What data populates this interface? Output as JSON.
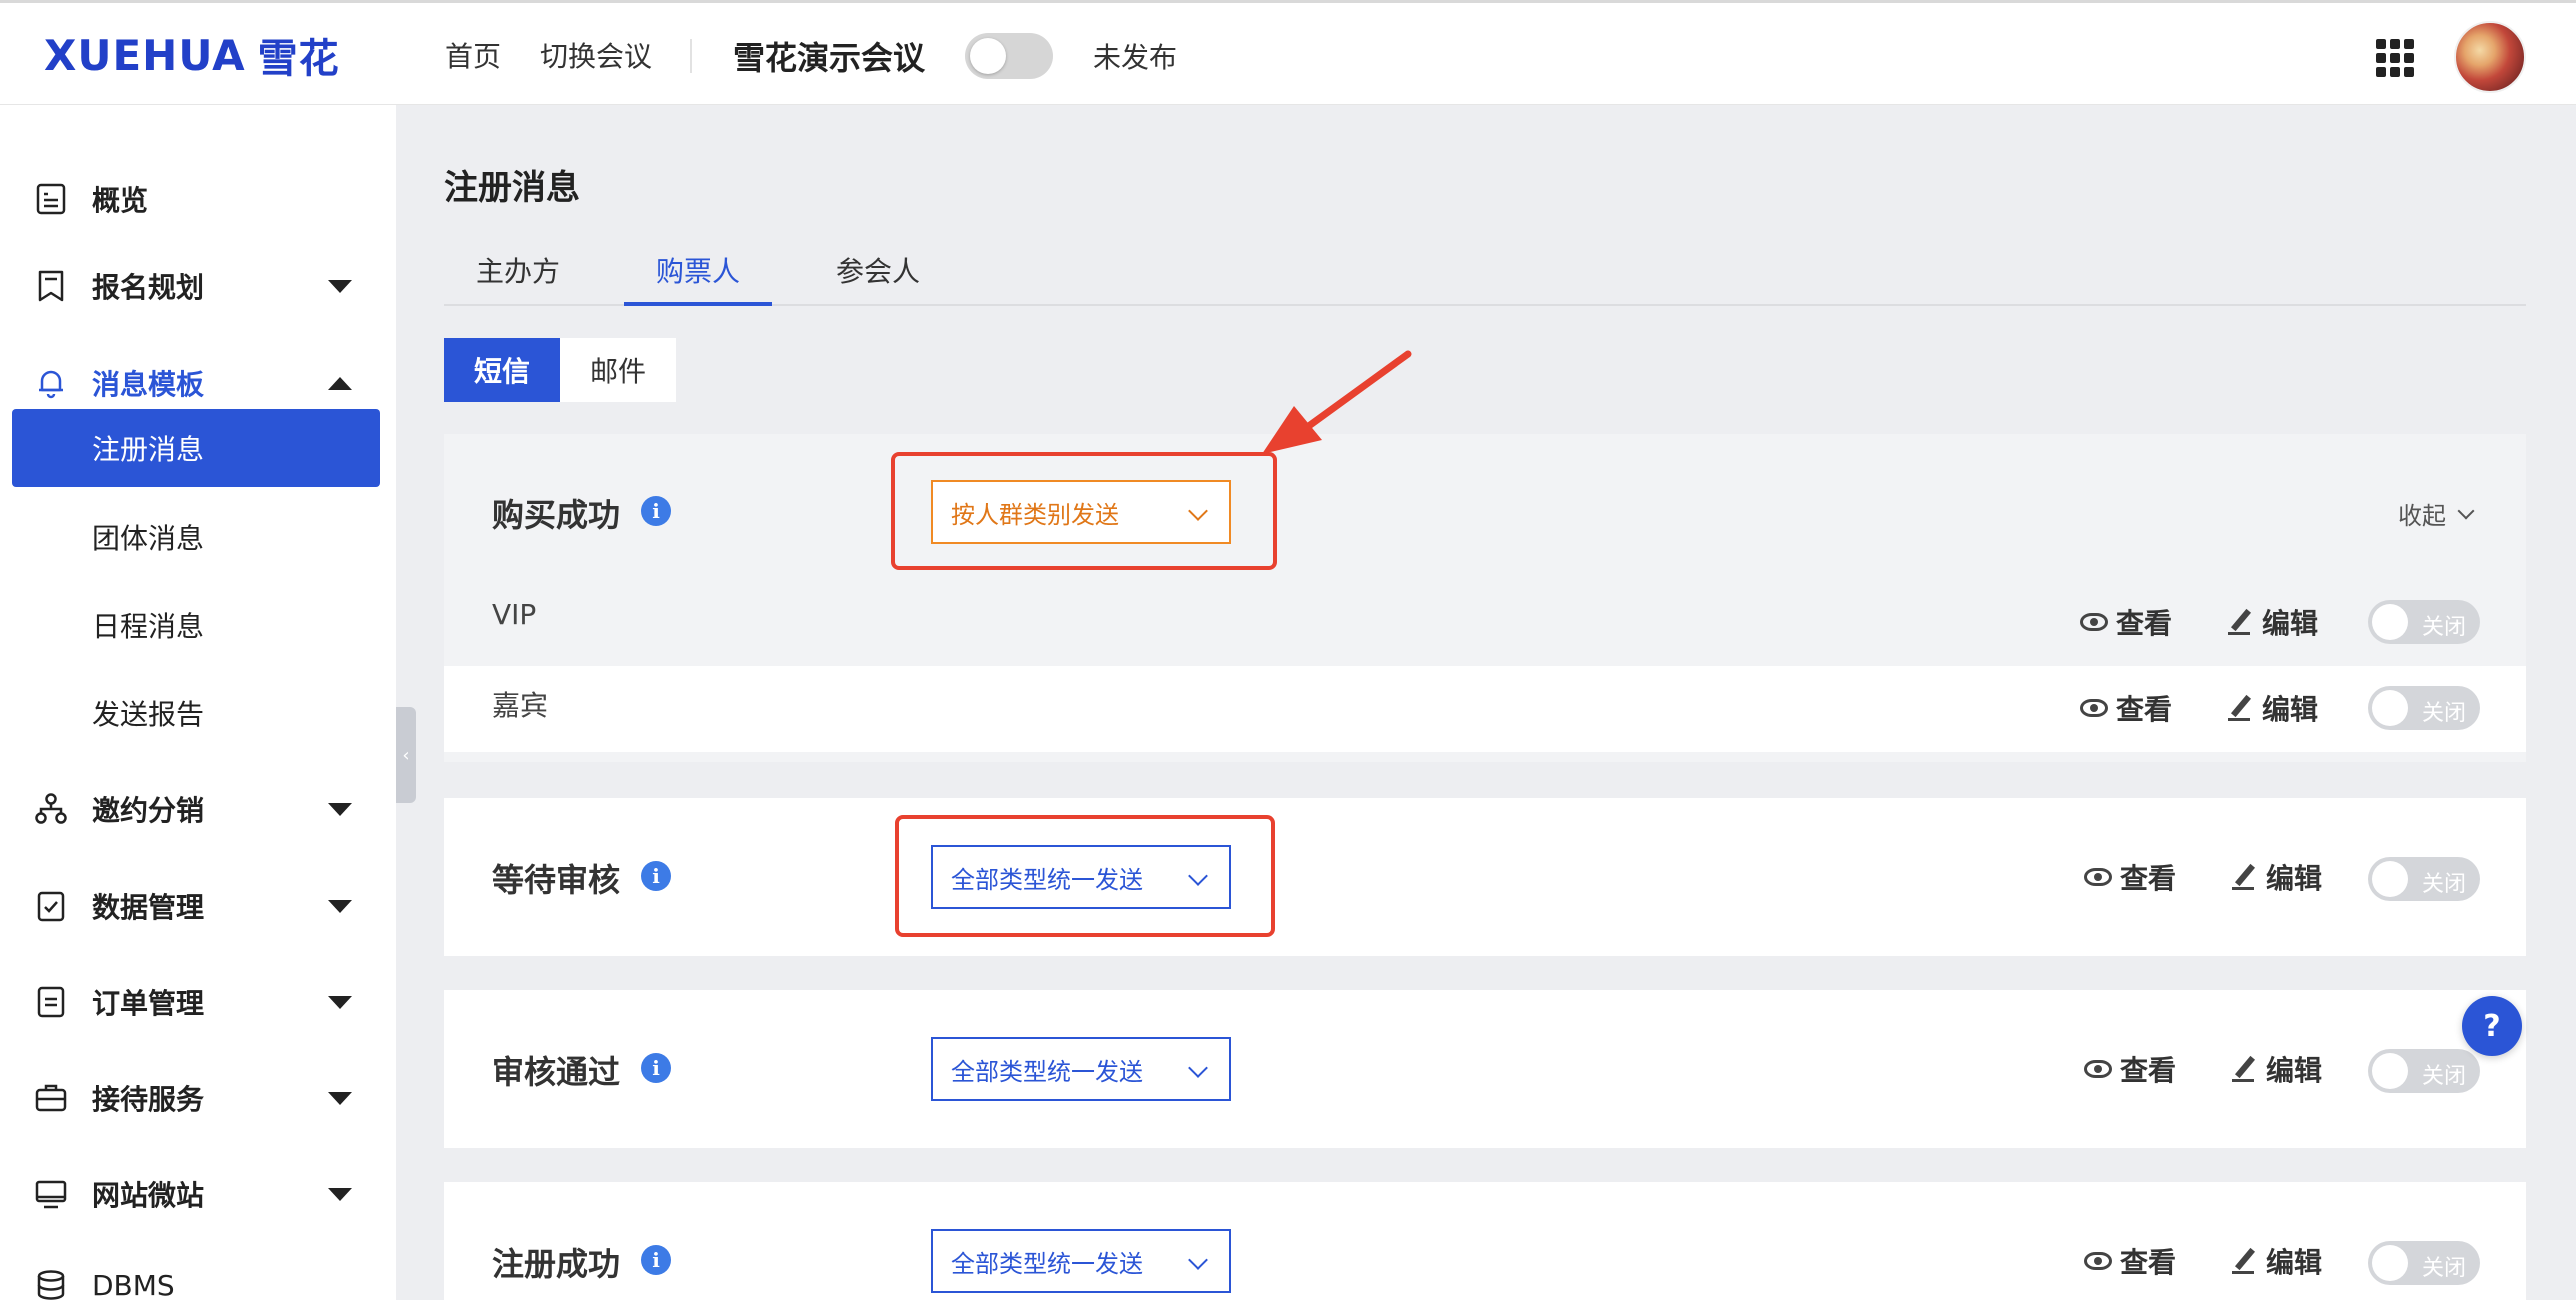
{
  "header": {
    "logo_text": "XUEHUA",
    "logo_cn": "雪花",
    "nav": [
      "首页",
      "切换会议"
    ],
    "conference_name": "雪花演示会议",
    "publish_status": "未发布"
  },
  "sidebar": {
    "items": [
      {
        "label": "概览",
        "icon": "overview-icon"
      },
      {
        "label": "报名规划",
        "icon": "bookmark-icon"
      },
      {
        "label": "消息模板",
        "icon": "bell-icon"
      },
      {
        "label": "邀约分销",
        "icon": "network-icon"
      },
      {
        "label": "数据管理",
        "icon": "clipboard-check-icon"
      },
      {
        "label": "订单管理",
        "icon": "document-icon"
      },
      {
        "label": "接待服务",
        "icon": "briefcase-icon"
      },
      {
        "label": "网站微站",
        "icon": "monitor-icon"
      },
      {
        "label": "DBMS",
        "icon": "database-icon"
      }
    ],
    "sub_items": [
      "注册消息",
      "团体消息",
      "日程消息",
      "发送报告"
    ]
  },
  "main": {
    "title": "注册消息",
    "tabs": [
      "主办方",
      "购票人",
      "参会人"
    ],
    "channels": [
      "短信",
      "邮件"
    ],
    "view_label": "查看",
    "edit_label": "编辑",
    "off_label": "关闭",
    "collapse_label": "收起",
    "cards": [
      {
        "title": "购买成功",
        "select": "按人群类别发送",
        "rows": [
          "VIP",
          "嘉宾"
        ]
      },
      {
        "title": "等待审核",
        "select": "全部类型统一发送"
      },
      {
        "title": "审核通过",
        "select": "全部类型统一发送"
      },
      {
        "title": "注册成功",
        "select": "全部类型统一发送"
      }
    ],
    "help": "?"
  },
  "colors": {
    "brand": "#2240c8",
    "accent": "#2b55d6",
    "orange": "#e07718",
    "highlight": "#e8412f"
  }
}
